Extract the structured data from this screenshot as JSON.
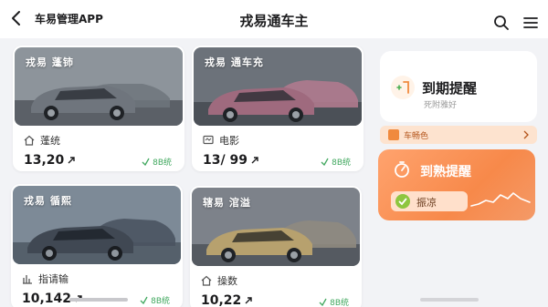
{
  "header": {
    "app_title": "车易管理APP",
    "page_title": "戎易通车主"
  },
  "cars": [
    {
      "name": "戎易 蓬铈",
      "stat_label": "蓬统",
      "stat_value": "13,20",
      "link": "8B统",
      "body_color": "#6f757d",
      "scene": "#8d949b"
    },
    {
      "name": "戎易 通车充",
      "stat_label": "电影",
      "stat_value": "13/ 99",
      "link": "8B统",
      "body_color": "#b07a8e",
      "scene": "#6c727a"
    },
    {
      "name": "戎易 循熙",
      "stat_label": "指请输",
      "stat_value": "10,142",
      "link": "8B统",
      "body_color": "#4a5360",
      "scene": "#7d8a97"
    },
    {
      "name": "辖易 涫溢",
      "stat_label": "操数",
      "stat_value": "10,22",
      "link": "8B统",
      "body_color": "#b7a16e",
      "scene": "#7d828a"
    }
  ],
  "sidebar": {
    "remind_title": "到期提醒",
    "remind_sub": "死附雅好",
    "strip_label": "车畅色",
    "heat_title": "到熟提醒",
    "heat_pill": "振凉"
  },
  "colors": {
    "accent": "#f7894a",
    "link_green": "#41a85f"
  }
}
